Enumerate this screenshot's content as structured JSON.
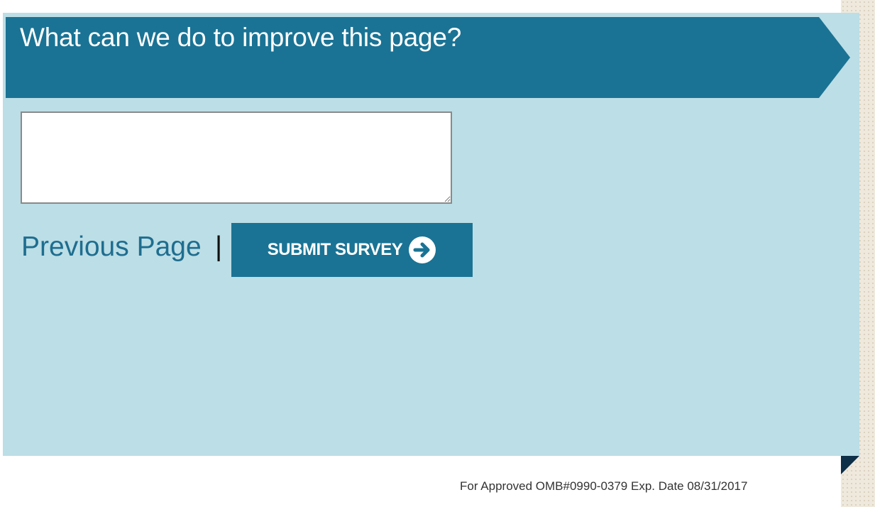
{
  "survey": {
    "title": "What can we do to improve this page?",
    "textarea_value": "",
    "textarea_placeholder": ""
  },
  "actions": {
    "previous_label": "Previous Page",
    "separator": "|",
    "submit_label": "SUBMIT SURVEY",
    "submit_icon": "arrow-right-circle-icon"
  },
  "footer": {
    "omb_note": "For Approved OMB#0990-0379 Exp. Date 08/31/2017"
  },
  "colors": {
    "banner": "#1a7394",
    "panel": "#bcdee6",
    "link": "#1e6d8f"
  }
}
